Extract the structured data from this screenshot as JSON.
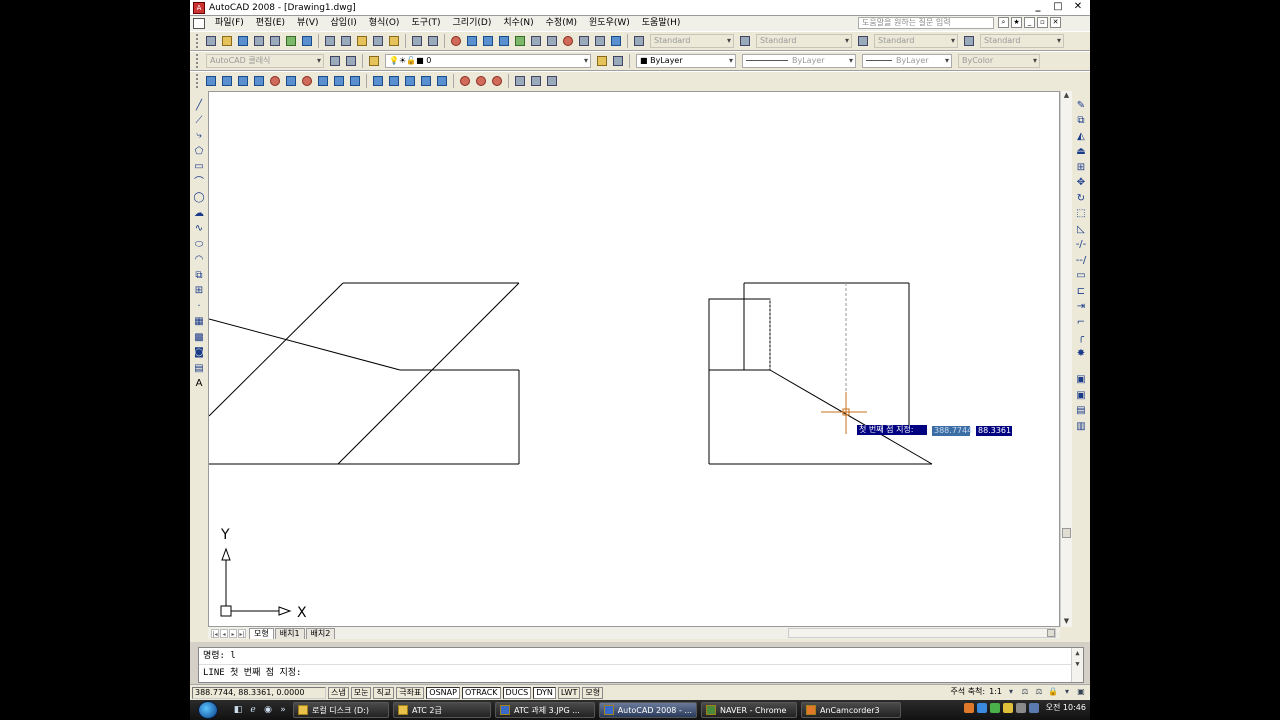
{
  "window": {
    "title": "AutoCAD 2008 - [Drawing1.dwg]",
    "controls": [
      "_",
      "□",
      "✕"
    ],
    "doc_controls": [
      "_",
      "▫",
      "✕"
    ]
  },
  "menu": {
    "items": [
      "파일(F)",
      "편집(E)",
      "뷰(V)",
      "삽입(I)",
      "형식(O)",
      "도구(T)",
      "그리기(D)",
      "치수(N)",
      "수정(M)",
      "윈도우(W)",
      "도움말(H)"
    ],
    "help_placeholder": "도움말을 원하는 질문 입력"
  },
  "toolbar_styles": {
    "text_style": "Standard",
    "dim_style": "Standard",
    "table_style": "Standard",
    "mleader_style": "Standard"
  },
  "toolbar_props": {
    "workspace": "AutoCAD 클래식",
    "layer": "0",
    "color": "ByLayer",
    "linetype": "ByLayer",
    "lineweight": "ByLayer",
    "plotstyle": "ByColor"
  },
  "tabs": {
    "items": [
      "모형",
      "배치1",
      "배치2"
    ],
    "active": "모형"
  },
  "ucs": {
    "x_label": "X",
    "y_label": "Y"
  },
  "dynamic_input": {
    "prompt": "첫 번째 점 지정:",
    "value1": "388.7744",
    "value2": "88.3361"
  },
  "command": {
    "line1": "명령: l",
    "line2": "LINE 첫 번째 점 지정:"
  },
  "status": {
    "coords": "388.7744, 88.3361, 0.0000",
    "buttons": [
      "스냅",
      "모눈",
      "직교",
      "극좌표",
      "OSNAP",
      "OTRACK",
      "DUCS",
      "DYN",
      "LWT",
      "모형"
    ],
    "annotation_scale_label": "주석 축척:",
    "annotation_scale": "1:1"
  },
  "taskbar": {
    "tasks": [
      {
        "label": "로컬 디스크 (D:)",
        "icon": "folder-icon"
      },
      {
        "label": "ATC 2급",
        "icon": "folder-icon"
      },
      {
        "label": "ATC 과제 3.JPG ...",
        "icon": "image-icon"
      },
      {
        "label": "AutoCAD 2008 - ...",
        "icon": "autocad-icon"
      },
      {
        "label": "NAVER - Chrome",
        "icon": "chrome-icon"
      },
      {
        "label": "AnCamcorder3",
        "icon": "camcorder-icon"
      }
    ],
    "clock": "오전 10:46"
  },
  "colors": {
    "canvas_bg": "#ffffff",
    "chrome_bg": "#ece9d8",
    "tooltip_bg": "#000080",
    "line_color": "#000000"
  }
}
